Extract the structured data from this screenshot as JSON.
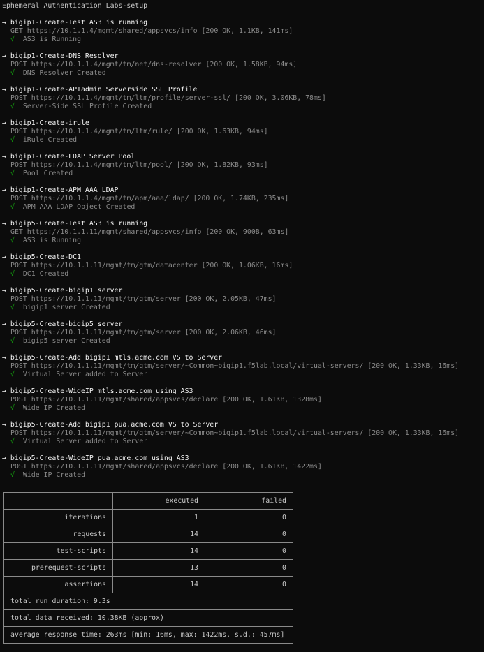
{
  "title": "Ephemeral Authentication Labs-setup",
  "requests": [
    {
      "name": "bigip1-Create-Test AS3 is running",
      "request": "GET https://10.1.1.4/mgmt/shared/appsvcs/info [200 OK, 1.1KB, 141ms]",
      "check": "AS3 is Running"
    },
    {
      "name": "bigip1-Create-DNS Resolver",
      "request": "POST https://10.1.1.4/mgmt/tm/net/dns-resolver [200 OK, 1.58KB, 94ms]",
      "check": "DNS Resolver Created"
    },
    {
      "name": "bigip1-Create-APIadmin Serverside SSL Profile",
      "request": "POST https://10.1.1.4/mgmt/tm/ltm/profile/server-ssl/ [200 OK, 3.06KB, 78ms]",
      "check": "Server-Side SSL Profile Created"
    },
    {
      "name": "bigip1-Create-irule",
      "request": "POST https://10.1.1.4/mgmt/tm/ltm/rule/ [200 OK, 1.63KB, 94ms]",
      "check": "iRule Created"
    },
    {
      "name": "bigip1-Create-LDAP Server Pool",
      "request": "POST https://10.1.1.4/mgmt/tm/ltm/pool/ [200 OK, 1.82KB, 93ms]",
      "check": "Pool Created"
    },
    {
      "name": "bigip1-Create-APM AAA LDAP",
      "request": "POST https://10.1.1.4/mgmt/tm/apm/aaa/ldap/ [200 OK, 1.74KB, 235ms]",
      "check": "APM AAA LDAP Object Created"
    },
    {
      "name": "bigip5-Create-Test AS3 is running",
      "request": "GET https://10.1.1.11/mgmt/shared/appsvcs/info [200 OK, 900B, 63ms]",
      "check": "AS3 is Running"
    },
    {
      "name": "bigip5-Create-DC1",
      "request": "POST https://10.1.1.11/mgmt/tm/gtm/datacenter [200 OK, 1.06KB, 16ms]",
      "check": "DC1 Created"
    },
    {
      "name": "bigip5-Create-bigip1 server",
      "request": "POST https://10.1.1.11/mgmt/tm/gtm/server [200 OK, 2.05KB, 47ms]",
      "check": "bigip1 server Created"
    },
    {
      "name": "bigip5-Create-bigip5 server",
      "request": "POST https://10.1.1.11/mgmt/tm/gtm/server [200 OK, 2.06KB, 46ms]",
      "check": "bigip5 server Created"
    },
    {
      "name": "bigip5-Create-Add bigip1 mtls.acme.com VS to Server",
      "request": "POST https://10.1.1.11/mgmt/tm/gtm/server/~Common~bigip1.f5lab.local/virtual-servers/ [200 OK, 1.33KB, 16ms]",
      "check": "Virtual Server added to Server"
    },
    {
      "name": "bigip5-Create-WideIP mtls.acme.com using AS3",
      "request": "POST https://10.1.1.11/mgmt/shared/appsvcs/declare [200 OK, 1.61KB, 1328ms]",
      "check": "Wide IP Created"
    },
    {
      "name": "bigip5-Create-Add bigip1 pua.acme.com VS to Server",
      "request": "POST https://10.1.1.11/mgmt/tm/gtm/server/~Common~bigip1.f5lab.local/virtual-servers/ [200 OK, 1.33KB, 16ms]",
      "check": "Virtual Server added to Server"
    },
    {
      "name": "bigip5-Create-WideIP pua.acme.com using AS3",
      "request": "POST https://10.1.1.11/mgmt/shared/appsvcs/declare [200 OK, 1.61KB, 1422ms]",
      "check": "Wide IP Created"
    }
  ],
  "arrow_glyph": "→",
  "check_glyph": "√",
  "summary": {
    "headers": [
      "",
      "executed",
      "failed"
    ],
    "rows": [
      {
        "label": "iterations",
        "executed": "1",
        "failed": "0"
      },
      {
        "label": "requests",
        "executed": "14",
        "failed": "0"
      },
      {
        "label": "test-scripts",
        "executed": "14",
        "failed": "0"
      },
      {
        "label": "prerequest-scripts",
        "executed": "13",
        "failed": "0"
      },
      {
        "label": "assertions",
        "executed": "14",
        "failed": "0"
      }
    ],
    "duration": "total run duration: 9.3s",
    "data_received": "total data received: 10.38KB (approx)",
    "response_time": "average response time: 263ms [min: 16ms, max: 1422ms, s.d.: 457ms]"
  },
  "colors": {
    "background": "#0c0c0c",
    "name_text": "#f2f2f2",
    "request_text": "#8a8a8a",
    "check_text": "#13a10e"
  }
}
